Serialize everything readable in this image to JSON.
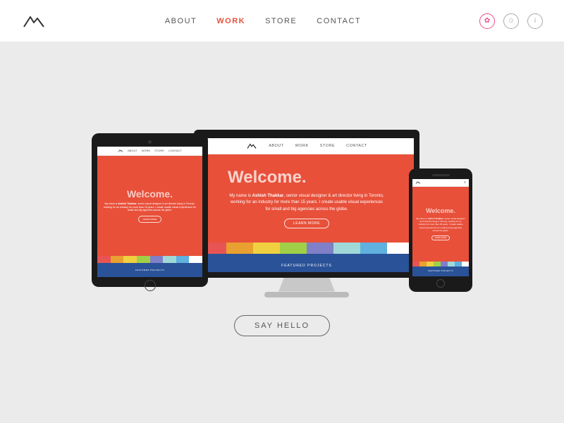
{
  "header": {
    "logo_alt": "Mountain Logo",
    "nav": {
      "about": "ABOUT",
      "work": "WORK",
      "store": "STORE",
      "contact": "CONTACT"
    },
    "icons": [
      "dribbble-icon",
      "smiley-icon",
      "info-icon"
    ]
  },
  "main": {
    "monitor": {
      "hero_title": "Welcome.",
      "hero_text_plain": "My name is ",
      "hero_name": "Ashish Thakkar",
      "hero_text_rest": ", senior visual designer & art director living in Toronto, working for an industry for more than 15 years. I create usable visual experiences for small and big agencies across the globe.",
      "learn_more": "LEARN MORE",
      "nav_about": "ABOUT",
      "nav_work": "WORK",
      "nav_store": "STORE",
      "nav_contact": "CONTACT",
      "footer_label": "FEATURED PROJECTS"
    },
    "tablet": {
      "hero_title": "Welcome.",
      "footer_label": "FEATURED PROJECTS"
    },
    "phone": {
      "hero_title": "Welcome.",
      "footer_label": "FEATURED PROJECTS"
    },
    "say_hello": "SAY HELLO"
  },
  "colors": {
    "brand_red": "#e8503a",
    "brand_blue": "#2a5298",
    "nav_active": "#e8503a"
  }
}
